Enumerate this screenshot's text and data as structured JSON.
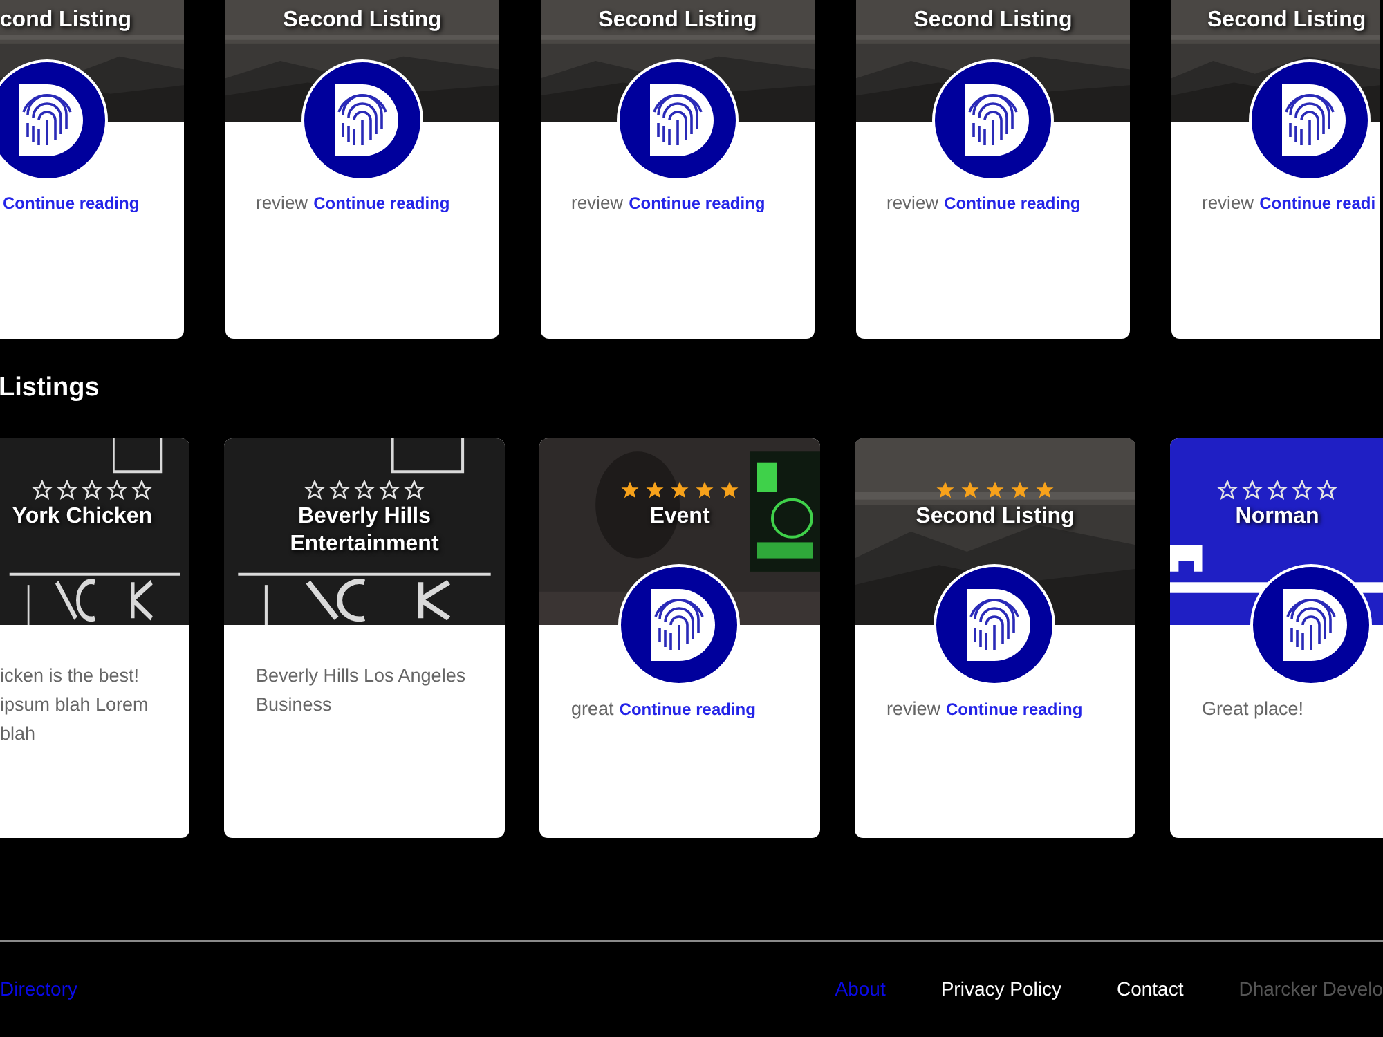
{
  "top_listings": [
    {
      "title": "cond Listing",
      "link": "Continue reading"
    },
    {
      "title": "Second Listing",
      "text": "review",
      "link": "Continue reading"
    },
    {
      "title": "Second Listing",
      "text": "review",
      "link": "Continue reading"
    },
    {
      "title": "Second Listing",
      "text": "review",
      "link": "Continue reading"
    },
    {
      "title": "Second Listing",
      "text": "review",
      "link": "Continue readi"
    }
  ],
  "section_title": "Listings",
  "listings": [
    {
      "title": "York Chicken",
      "stars": 0,
      "avatar": false,
      "lines": [
        "icken is the best!",
        "ipsum blah Lorem",
        "blah"
      ]
    },
    {
      "title": "Beverly Hills Entertainment",
      "stars": 0,
      "avatar": false,
      "lines": [
        "Beverly Hills Los Angeles",
        "Business"
      ]
    },
    {
      "title": "Event",
      "stars": 5,
      "avatar": true,
      "lines": [
        "great"
      ],
      "link": "Continue reading"
    },
    {
      "title": "Second Listing",
      "stars": 5,
      "avatar": true,
      "lines": [
        "review"
      ],
      "link": "Continue reading"
    },
    {
      "title": "Norman",
      "stars": 0,
      "avatar": true,
      "lines": [
        "Great place!"
      ]
    }
  ],
  "footer": {
    "brand": "Directory",
    "links": [
      {
        "label": "About",
        "selected": true
      },
      {
        "label": "Privacy Policy",
        "selected": false
      },
      {
        "label": "Contact",
        "selected": false
      }
    ],
    "credit": "Dharcker Develo"
  }
}
